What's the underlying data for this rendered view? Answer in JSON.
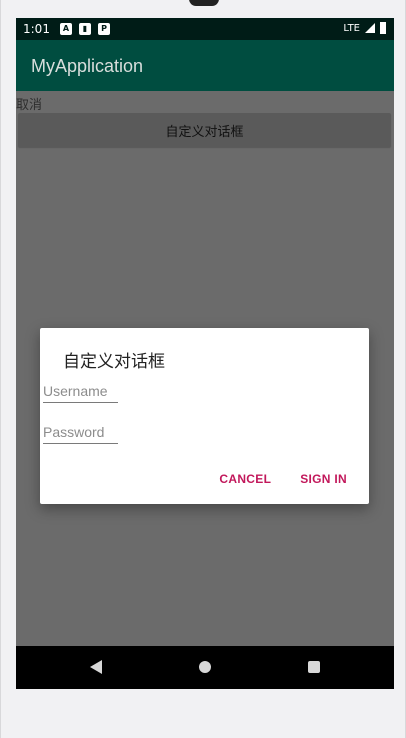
{
  "status_bar": {
    "time": "1:01",
    "network": "LTE",
    "icons": [
      "app-a-icon",
      "sd-card-icon",
      "pinterest-icon",
      "lte-signal-icon",
      "battery-icon"
    ]
  },
  "app_bar": {
    "title": "MyApplication"
  },
  "main": {
    "cancel_text": "取消",
    "custom_dialog_button": "自定义对话框"
  },
  "dialog": {
    "title": "自定义对话框",
    "username_placeholder": "Username",
    "password_placeholder": "Password",
    "cancel_label": "CANCEL",
    "sign_in_label": "SIGN IN"
  },
  "navigation": {
    "icons": [
      "back-icon",
      "home-icon",
      "recents-icon"
    ]
  },
  "colors": {
    "status_bar": "#001c17",
    "app_bar": "#004d40",
    "dim_background": "#6b6b6b",
    "dialog_action": "#c2185b"
  }
}
